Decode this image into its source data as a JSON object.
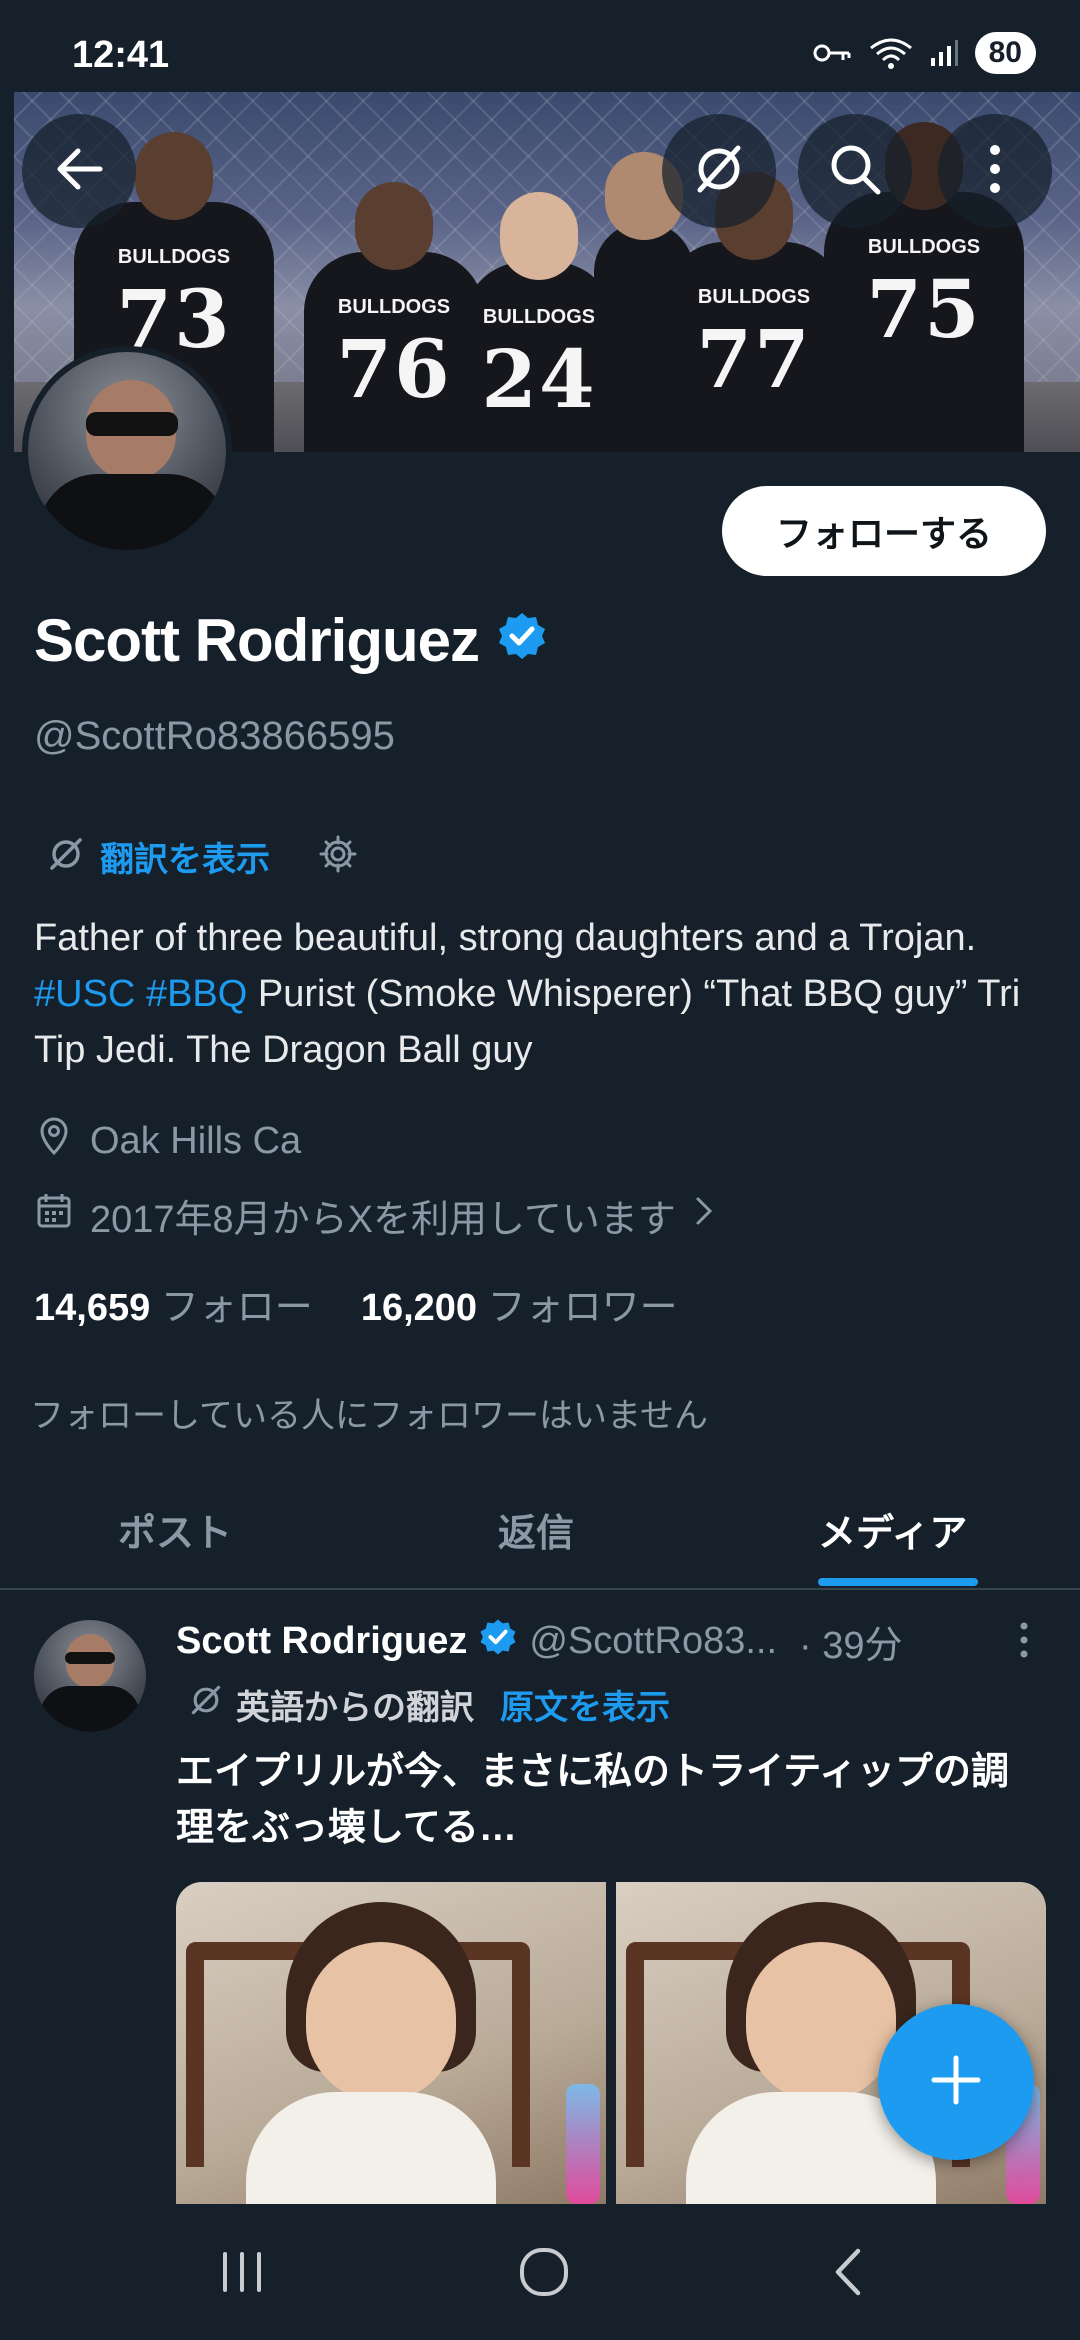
{
  "status_bar": {
    "time": "12:41",
    "battery": "80",
    "icons": [
      "vpn-key-icon",
      "wifi-icon",
      "signal-icon",
      "battery-icon"
    ]
  },
  "banner": {
    "icons": [
      "back-arrow-icon",
      "translate-off-icon",
      "search-icon",
      "more-vertical-icon"
    ]
  },
  "profile": {
    "follow_button": "フォローする",
    "name": "Scott Rodriguez",
    "handle": "@ScottRo83866595",
    "verified": true,
    "translate_link": "翻訳を表示",
    "bio_parts": {
      "p1": "Father of three beautiful, strong daughters and a Trojan. ",
      "tag1": "#USC",
      "sp": " ",
      "tag2": "#BBQ",
      "p2": " Purist (Smoke Whisperer) “That BBQ guy” Tri Tip Jedi. The Dragon Ball guy"
    },
    "location": "Oak Hills Ca",
    "joined": "2017年8月からXを利用しています",
    "following_count": "14,659",
    "following_label": "フォロー",
    "followers_count": "16,200",
    "followers_label": "フォロワー",
    "no_mutuals": "フォローしている人にフォロワーはいません"
  },
  "tabs": [
    {
      "label": "ポスト",
      "active": false
    },
    {
      "label": "返信",
      "active": false
    },
    {
      "label": "メディア",
      "active": true
    }
  ],
  "post": {
    "author": "Scott Rodriguez",
    "handle": "@ScottRo83...",
    "time": "· 39分",
    "translated_from": "英語からの翻訳",
    "show_original": "原文を表示",
    "text": "エイプリルが今、まさに私のトライティップの調理をぶっ壊してる…"
  },
  "colors": {
    "background": "#15202b",
    "accent": "#1d9bf0",
    "secondary_text": "#8b98a5"
  }
}
